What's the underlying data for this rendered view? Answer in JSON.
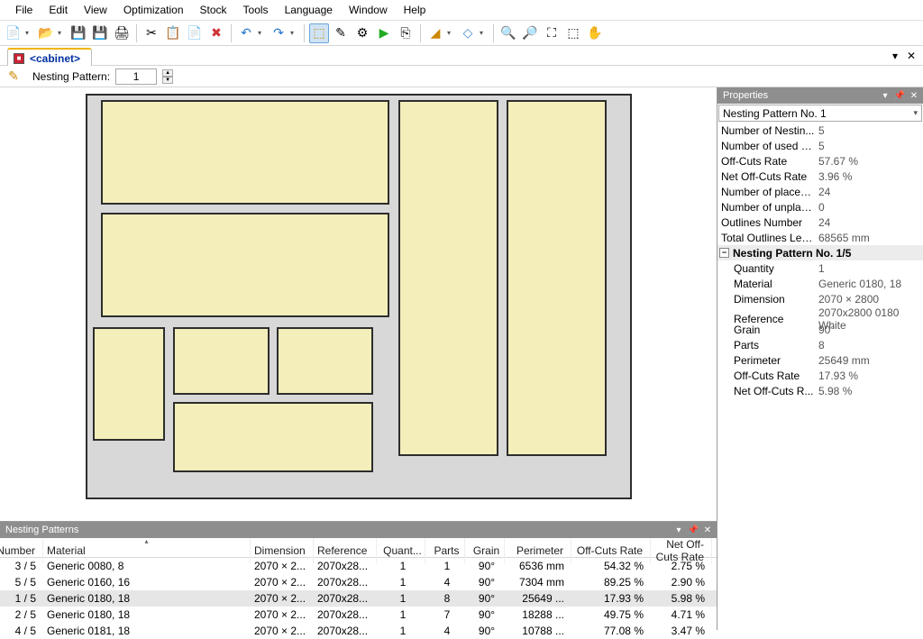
{
  "menu": [
    "File",
    "Edit",
    "View",
    "Optimization",
    "Stock",
    "Tools",
    "Language",
    "Window",
    "Help"
  ],
  "tab": {
    "name": "<cabinet>"
  },
  "subToolbar": {
    "label": "Nesting Pattern:",
    "value": "1"
  },
  "propertiesTitle": "Properties",
  "propCombo": "Nesting Pattern No. 1",
  "propsTop": [
    {
      "k": "Number of Nestin...",
      "v": "5"
    },
    {
      "k": "Number of used P...",
      "v": "5"
    },
    {
      "k": "Off-Cuts Rate",
      "v": "57.67 %"
    },
    {
      "k": "Net Off-Cuts Rate",
      "v": "3.96 %"
    },
    {
      "k": "Number of placed ...",
      "v": "24"
    },
    {
      "k": "Number of unplac...",
      "v": "0"
    },
    {
      "k": "Outlines Number",
      "v": "24"
    },
    {
      "k": "Total Outlines Len...",
      "v": "68565 mm"
    }
  ],
  "propGroup": "Nesting Pattern No. 1/5",
  "propsSub": [
    {
      "k": "Quantity",
      "v": "1"
    },
    {
      "k": "Material",
      "v": "Generic 0180, 18"
    },
    {
      "k": "Dimension",
      "v": "2070 × 2800"
    },
    {
      "k": "Reference",
      "v": "2070x2800 0180 White"
    },
    {
      "k": "Grain",
      "v": "90°"
    },
    {
      "k": "Parts",
      "v": "8"
    },
    {
      "k": "Perimeter",
      "v": "25649 mm"
    },
    {
      "k": "Off-Cuts Rate",
      "v": "17.93 %"
    },
    {
      "k": "Net Off-Cuts R...",
      "v": "5.98 %"
    }
  ],
  "nestingPanelTitle": "Nesting Patterns",
  "npColumns": [
    "Number",
    "Material",
    "Dimension",
    "Reference",
    "Quant...",
    "Parts",
    "Grain",
    "Perimeter",
    "Off-Cuts Rate",
    "Net Off-Cuts Rate"
  ],
  "npRows": [
    {
      "num": "3 / 5",
      "mat": "Generic 0080, 8",
      "dim": "2070 × 2...",
      "ref": "2070x28...",
      "qty": "1",
      "parts": "1",
      "grain": "90°",
      "perim": "6536 mm",
      "off": "54.32 %",
      "net": "2.75 %",
      "sel": false
    },
    {
      "num": "5 / 5",
      "mat": "Generic 0160, 16",
      "dim": "2070 × 2...",
      "ref": "2070x28...",
      "qty": "1",
      "parts": "4",
      "grain": "90°",
      "perim": "7304 mm",
      "off": "89.25 %",
      "net": "2.90 %",
      "sel": false
    },
    {
      "num": "1 / 5",
      "mat": "Generic 0180, 18",
      "dim": "2070 × 2...",
      "ref": "2070x28...",
      "qty": "1",
      "parts": "8",
      "grain": "90°",
      "perim": "25649 ...",
      "off": "17.93 %",
      "net": "5.98 %",
      "sel": true
    },
    {
      "num": "2 / 5",
      "mat": "Generic 0180, 18",
      "dim": "2070 × 2...",
      "ref": "2070x28...",
      "qty": "1",
      "parts": "7",
      "grain": "90°",
      "perim": "18288 ...",
      "off": "49.75 %",
      "net": "4.71 %",
      "sel": false
    },
    {
      "num": "4 / 5",
      "mat": "Generic 0181, 18",
      "dim": "2070 × 2...",
      "ref": "2070x28...",
      "qty": "1",
      "parts": "4",
      "grain": "90°",
      "perim": "10788 ...",
      "off": "77.08 %",
      "net": "3.47 %",
      "sel": false
    }
  ]
}
